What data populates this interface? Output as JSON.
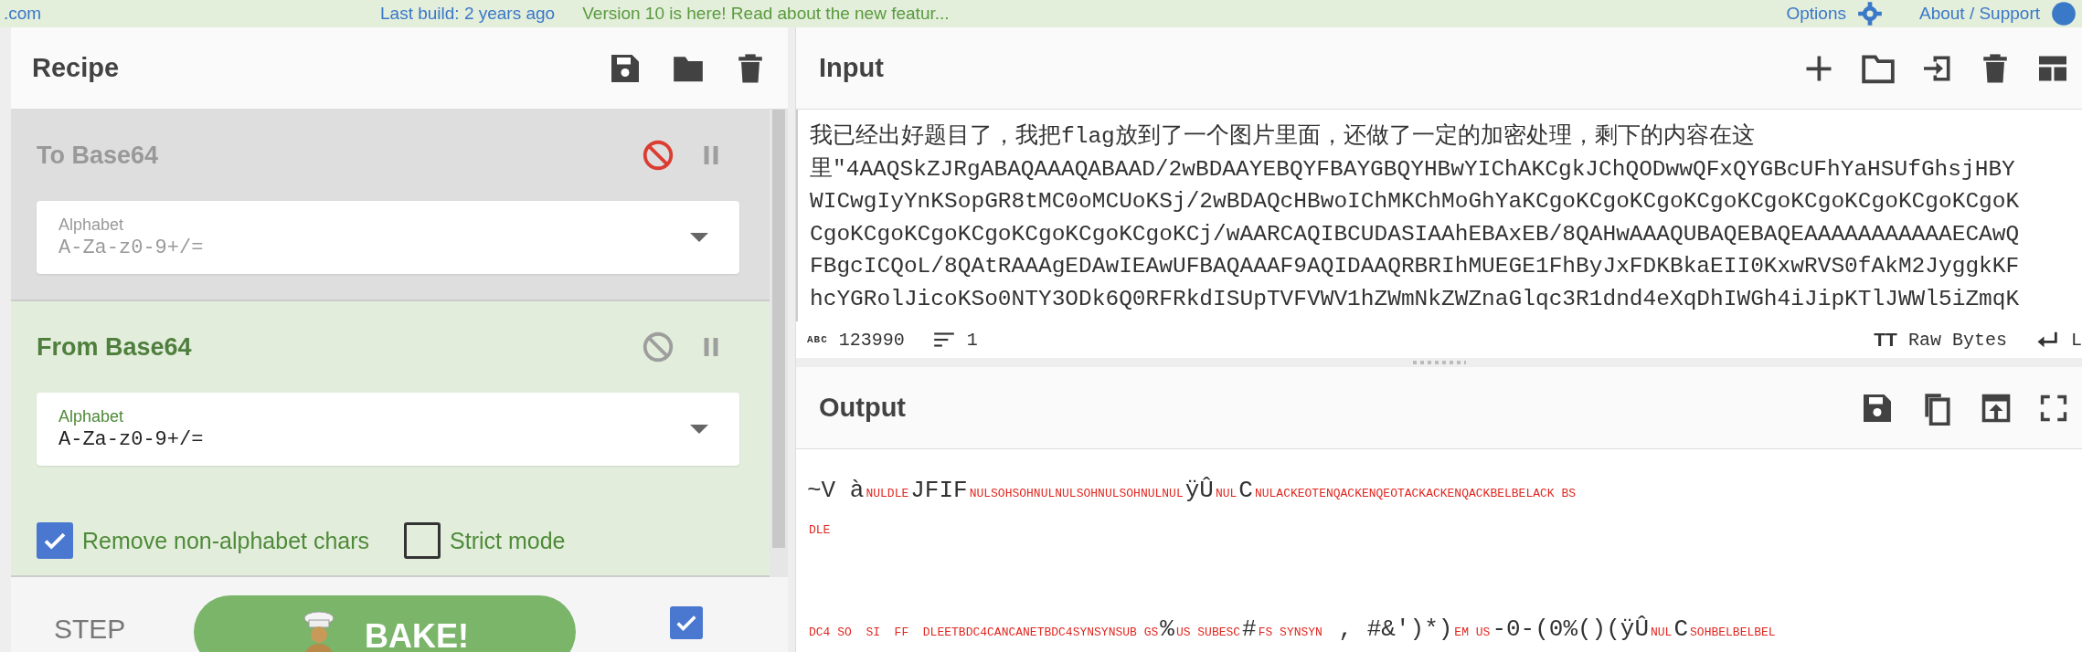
{
  "top_bar": {
    "brand": ".com",
    "last_build": "Last build: 2 years ago",
    "notice": "Version 10 is here! Read about the new featur...",
    "options": "Options",
    "about": "About / Support"
  },
  "recipe": {
    "title": "Recipe",
    "operations": [
      {
        "name": "To Base64",
        "disabled": true,
        "breakpoint": false,
        "args": [
          {
            "kind": "dropdown",
            "label": "Alphabet",
            "value": "A-Za-z0-9+/="
          }
        ]
      },
      {
        "name": "From Base64",
        "disabled": false,
        "breakpoint": false,
        "args": [
          {
            "kind": "dropdown",
            "label": "Alphabet",
            "value": "A-Za-z0-9+/="
          },
          {
            "kind": "checkbox",
            "label": "Remove non-alphabet chars",
            "checked": true
          },
          {
            "kind": "checkbox",
            "label": "Strict mode",
            "checked": false
          }
        ]
      }
    ]
  },
  "controls": {
    "step": "STEP",
    "bake": "BAKE!",
    "auto_bake_checked": true
  },
  "input": {
    "title": "Input",
    "lines": [
      "我已经出好题目了，我把flag放到了一个图片里面，还做了一定的加密处理，剩下的内容在这",
      "里\"4AAQSkZJRgABAQAAAQABAAD/2wBDAAYEBQYFBAYGBQYHBwYIChAKCgkJChQODwwQFxQYGBcUFhYaHSUfGhsjHBY",
      "WICwgIyYnKSopGR8tMC0oMCUoKSj/2wBDAQcHBwoIChMKChMoGhYaKCgoKCgoKCgoKCgoKCgoKCgoKCgoKCgoKCgoK",
      "CgoKCgoKCgoKCgoKCgoKCgoKCgoKCj/wAARCAQIBCUDASIAAhEBAxEB/8QAHwAAAQUBAQEBAQEAAAAAAAAAAAECAwQ",
      "FBgcICQoL/8QAtRAAAgEDAwIEAwUFBAQAAAF9AQIDAAQRBRIhMUEGE1FhByJxFDKBkaEII0KxwRVS0fAkM2JyggkKF",
      "hcYGRolJicoKSo0NTY3ODk6Q0RFRkdISUpTVFVWV1hZWmNkZWZnaGlqc3R1dnd4eXqDhIWGh4iJipKTlJWWl5iZmqK"
    ],
    "status": {
      "length_label": "ABC",
      "length": "123990",
      "line_count": "1",
      "format_glyph": "TT",
      "encoding": "Raw Bytes",
      "eol": "L"
    }
  },
  "output": {
    "title": "Output",
    "segments": [
      {
        "kind": "text",
        "text": "~V à"
      },
      {
        "kind": "ctrl",
        "text": "NULDLE"
      },
      {
        "kind": "text",
        "text": "JFIF"
      },
      {
        "kind": "ctrl",
        "text": "NULSOHSOHNULNULSOHNULSOHNULNUL"
      },
      {
        "kind": "text",
        "text": "ÿÛ"
      },
      {
        "kind": "ctrl",
        "text": "NUL"
      },
      {
        "kind": "text",
        "text": "C"
      },
      {
        "kind": "ctrl",
        "text": "NULACKEOTENQACKENQEOTACKACKENQACKBELBELACK BS"
      },
      {
        "kind": "break"
      },
      {
        "kind": "ctrl",
        "text": "DLE"
      },
      {
        "kind": "break"
      },
      {
        "kind": "break"
      },
      {
        "kind": "break"
      },
      {
        "kind": "ctrl",
        "text": "DC4 SO  SI  FF  DLEETBDC4CANCANETBDC4SYNSYNSUB GS"
      },
      {
        "kind": "text",
        "text": "%"
      },
      {
        "kind": "ctrl",
        "text": "US SUBESC"
      },
      {
        "kind": "text",
        "text": "#"
      },
      {
        "kind": "ctrl",
        "text": "FS SYNSYN"
      },
      {
        "kind": "text",
        "text": " , #&')*)"
      },
      {
        "kind": "ctrl",
        "text": "EM US"
      },
      {
        "kind": "text",
        "text": "-0-(0%()(ÿÛ"
      },
      {
        "kind": "ctrl",
        "text": "NUL"
      },
      {
        "kind": "text",
        "text": "C"
      },
      {
        "kind": "ctrl",
        "text": "SOHBELBELBEL"
      }
    ]
  }
}
